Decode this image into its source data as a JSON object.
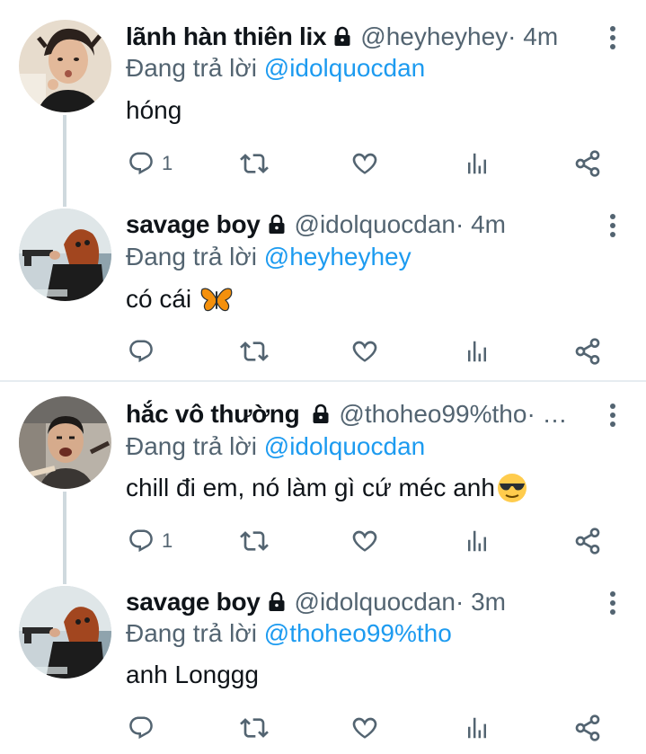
{
  "tweets": [
    {
      "name": "lãnh hàn thiên lix",
      "handle": "@heyheyhey",
      "time_sep": " · 4m",
      "reply_label": "Đang trả lời ",
      "reply_to": "@idolquocdan",
      "text": "hóng",
      "reply_count": "1"
    },
    {
      "name": "savage boy",
      "handle": "@idolquocdan",
      "time_sep": " · 4m",
      "reply_label": "Đang trả lời ",
      "reply_to": "@heyheyhey",
      "text": "có cái",
      "reply_count": ""
    },
    {
      "name": "hắc vô thường",
      "handle": "@thoheo99%tho",
      "time_sep": " · …",
      "reply_label": "Đang trả lời ",
      "reply_to": "@idolquocdan",
      "text": "chill đi em, nó làm gì cứ méc anh",
      "reply_count": "1"
    },
    {
      "name": "savage boy",
      "handle": "@idolquocdan",
      "time_sep": " · 3m",
      "reply_label": "Đang trả lời ",
      "reply_to": "@thoheo99%tho",
      "text": "anh Longgg",
      "reply_count": ""
    }
  ],
  "colors": {
    "mention": "#1d9bf0",
    "secondary": "#536471",
    "primary": "#0f1419"
  },
  "icons": [
    "reply-icon",
    "retweet-icon",
    "like-icon",
    "views-icon",
    "share-icon",
    "lock-icon",
    "more-icon"
  ]
}
